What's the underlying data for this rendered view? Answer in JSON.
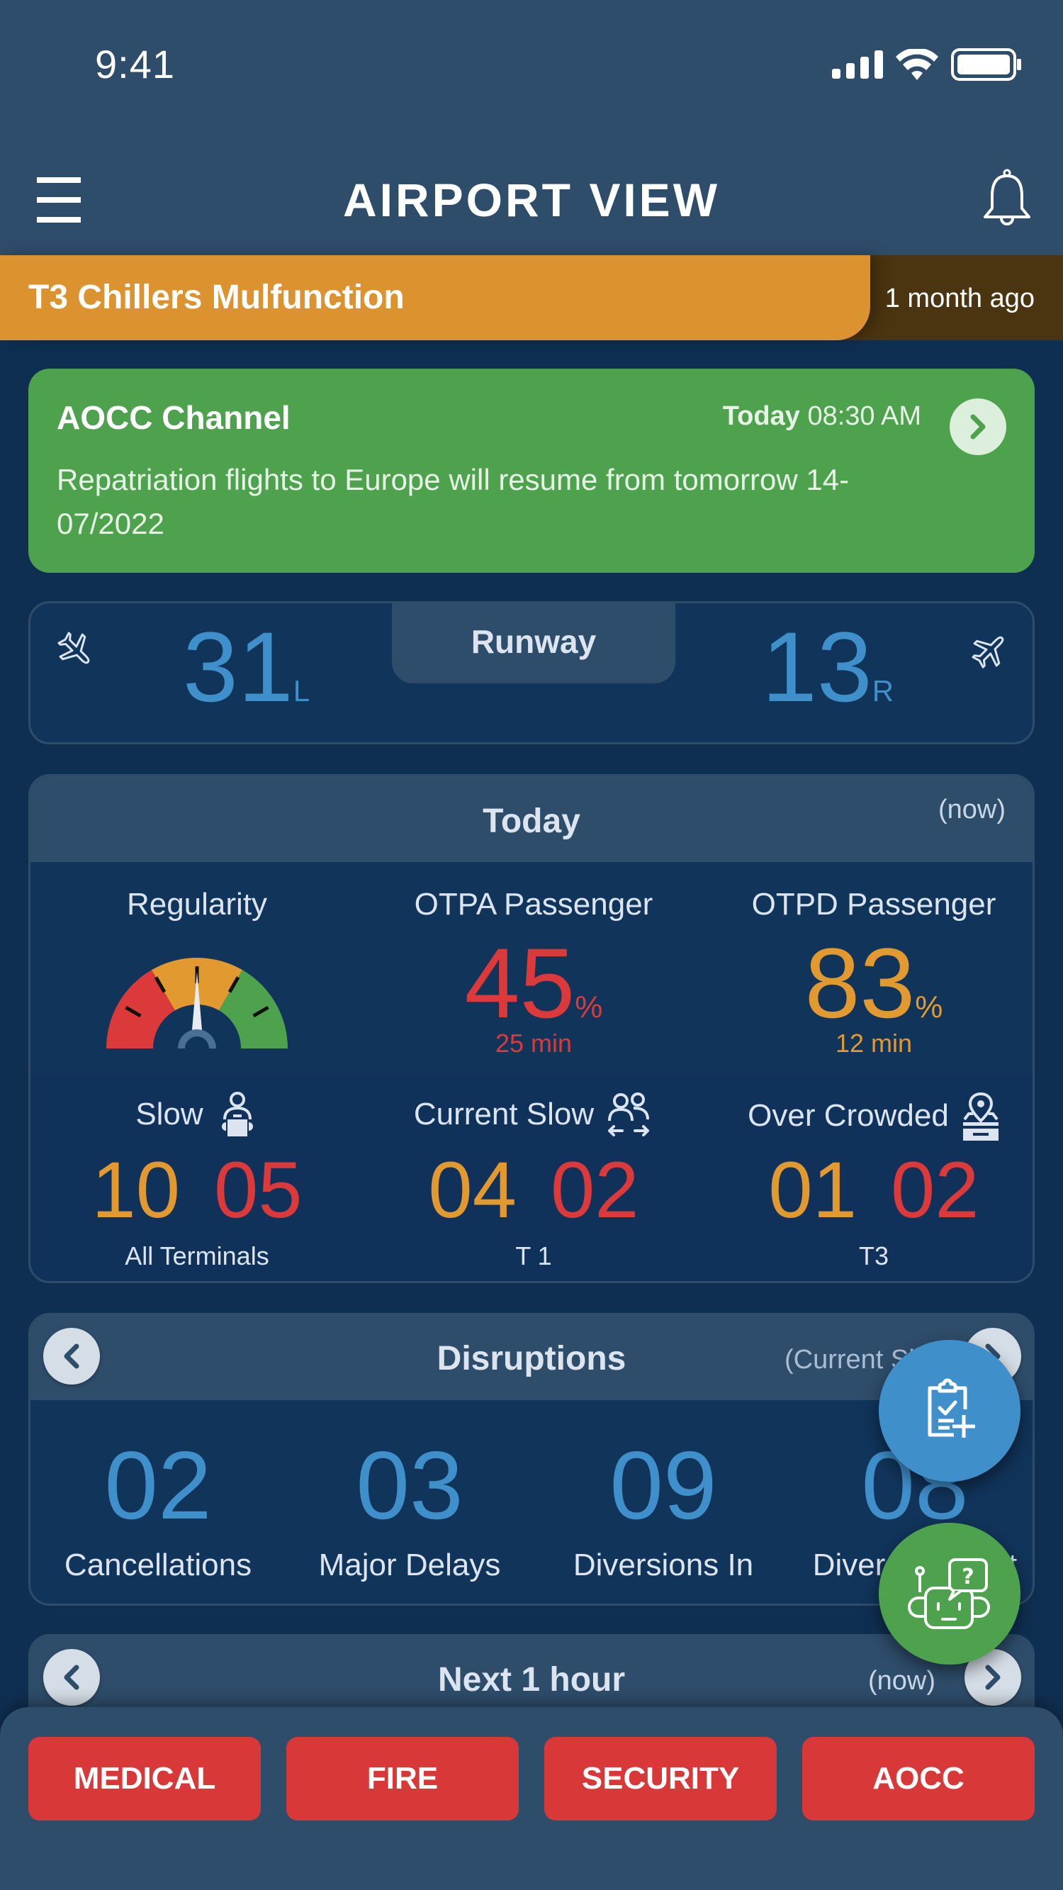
{
  "status_bar": {
    "time": "9:41",
    "icons": [
      "cellular-signal-icon",
      "wifi-icon",
      "battery-icon"
    ]
  },
  "header": {
    "title": "AIRPORT VIEW",
    "menu_icon": "hamburger-menu-icon",
    "notification_icon": "bell-icon"
  },
  "alert_banner": {
    "title": "T3 Chillers Mulfunction",
    "time": "1 month ago",
    "color": "#db922f"
  },
  "aocc_channel": {
    "title": "AOCC Channel",
    "date_label": "Today",
    "time": "08:30 AM",
    "message": "Repatriation flights to Europe will resume from tomorrow 14-07/2022",
    "color": "#4ea24e"
  },
  "runway": {
    "label": "Runway",
    "arrival": {
      "number": "31",
      "side": "L",
      "icon": "plane-landing-icon"
    },
    "departure": {
      "number": "13",
      "side": "R",
      "icon": "plane-takeoff-icon"
    }
  },
  "today": {
    "title": "Today",
    "subtitle": "(now)",
    "regularity": {
      "label": "Regularity",
      "gauge_value_fraction": 0.5
    },
    "otpa": {
      "label": "OTPA Passenger",
      "value": "45",
      "unit": "%",
      "delay": "25 min",
      "color": "#dc3a3a"
    },
    "otpd": {
      "label": "OTPD Passenger",
      "value": "83",
      "unit": "%",
      "delay": "12 min",
      "color": "#e2992f"
    },
    "counts": [
      {
        "label": "Slow",
        "icon": "passenger-luggage-icon",
        "warning": "10",
        "critical": "05",
        "scope": "All Terminals"
      },
      {
        "label": "Current Slow",
        "icon": "passengers-transfer-icon",
        "warning": "04",
        "critical": "02",
        "scope": "T 1"
      },
      {
        "label": "Over Crowded",
        "icon": "location-counter-icon",
        "warning": "01",
        "critical": "02",
        "scope": "T3"
      }
    ]
  },
  "disruptions": {
    "title": "Disruptions",
    "subtitle": "(Current Shift)",
    "items": [
      {
        "value": "02",
        "label": "Cancellations"
      },
      {
        "value": "03",
        "label": "Major Delays"
      },
      {
        "value": "09",
        "label": "Diversions In"
      },
      {
        "value": "08",
        "label": "Diversions Out"
      }
    ]
  },
  "next_hour": {
    "title": "Next 1 hour",
    "subtitle": "(now)"
  },
  "fabs": {
    "checklist": "clipboard-add-icon",
    "assistant": "chatbot-help-icon"
  },
  "emergency_buttons": [
    {
      "label": "MEDICAL"
    },
    {
      "label": "FIRE"
    },
    {
      "label": "SECURITY"
    },
    {
      "label": "AOCC"
    }
  ],
  "colors": {
    "warning": "#e2992f",
    "critical": "#dc3a3a",
    "info": "#3f8fcb",
    "emergency": "#d93838"
  }
}
